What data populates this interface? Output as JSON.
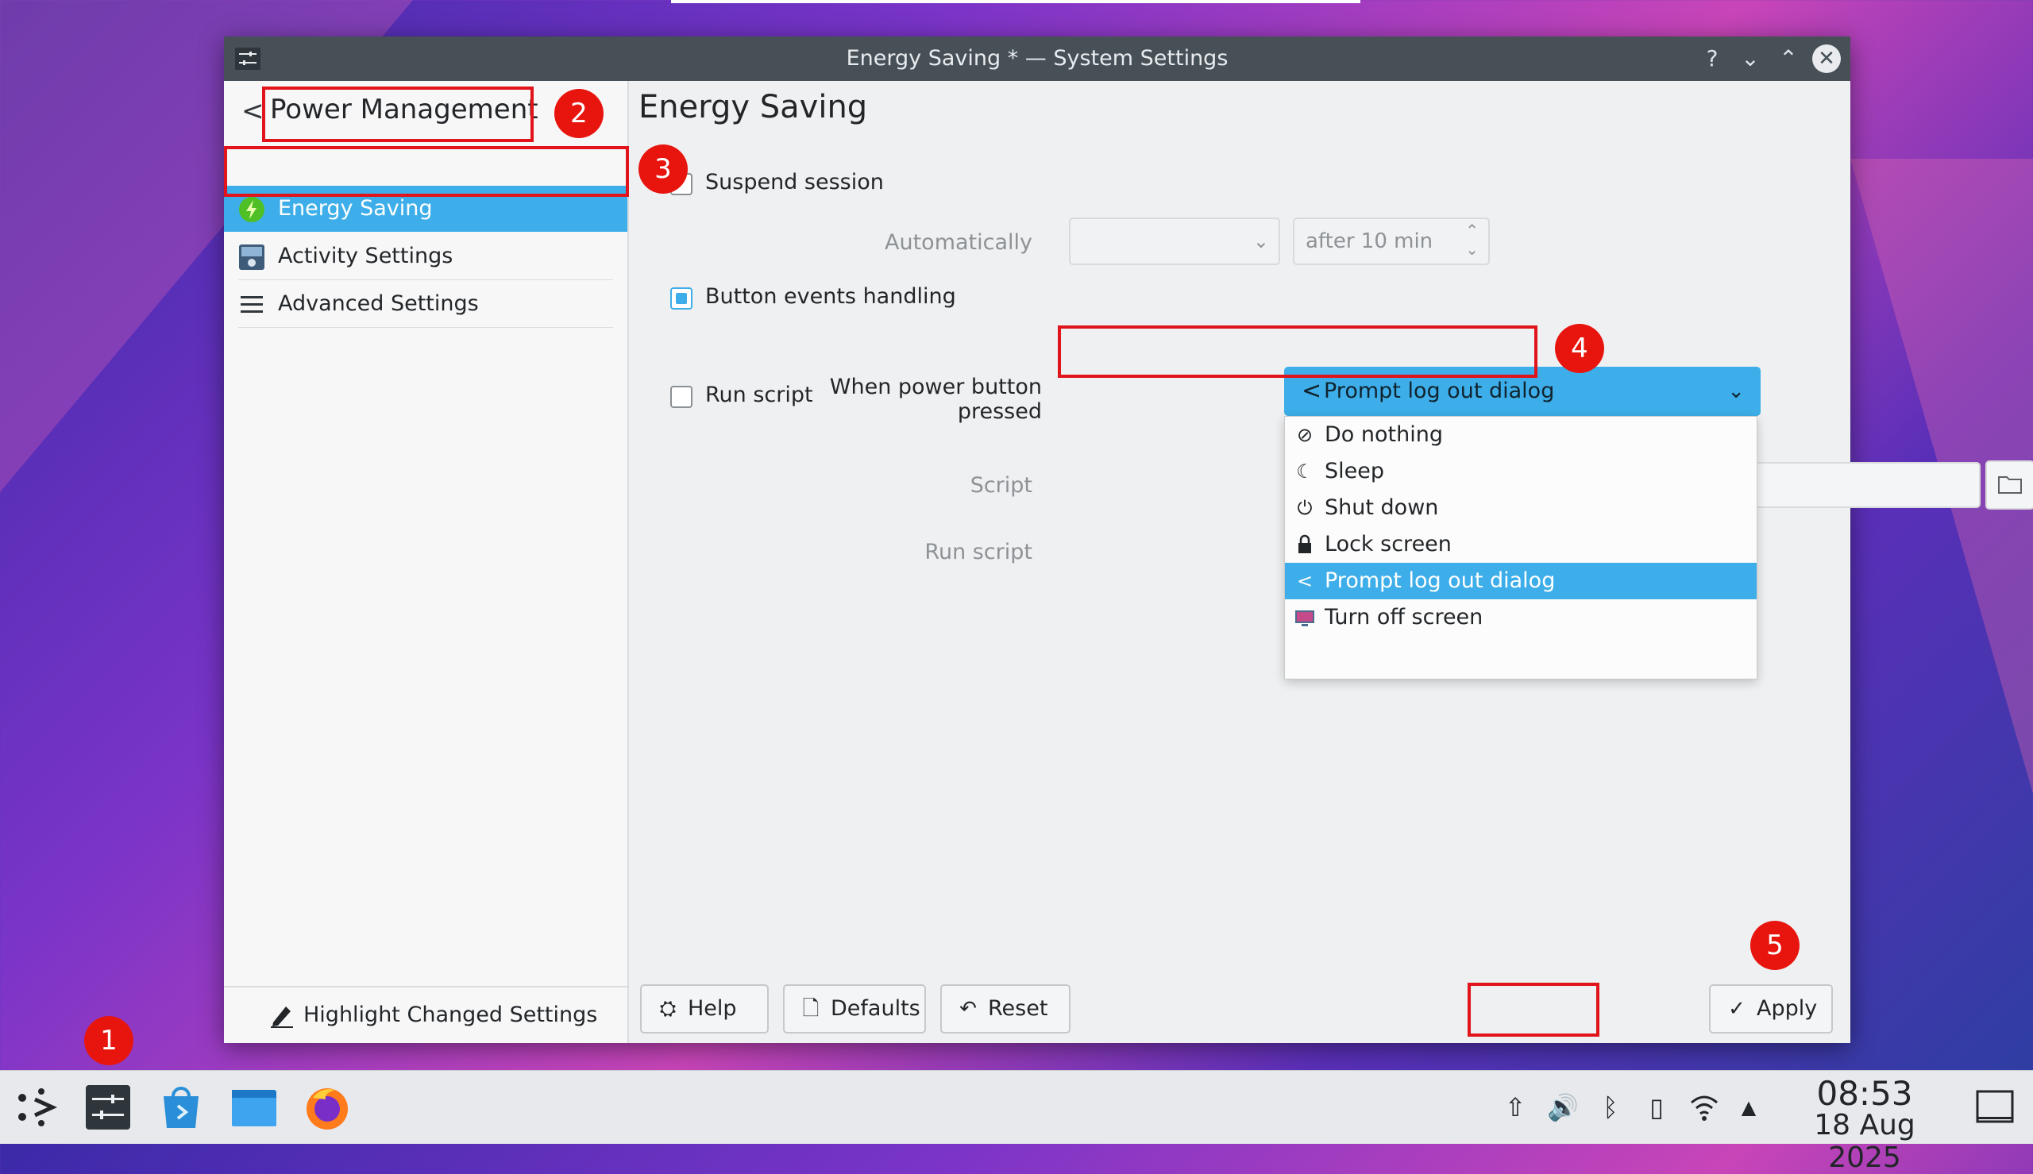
{
  "window": {
    "title": "Energy Saving * — System Settings",
    "help_glyph": "?",
    "minimize_glyph": "⌄",
    "maximize_glyph": "⌃",
    "close_glyph": "✕"
  },
  "sidebar": {
    "back_glyph": "<",
    "title": "Power Management",
    "items": [
      {
        "label": "Energy Saving",
        "icon": "energy-saving-icon",
        "selected": true
      },
      {
        "label": "Activity Settings",
        "icon": "activity-settings-icon",
        "selected": false
      },
      {
        "label": "Advanced Settings",
        "icon": "hamburger-menu-icon",
        "selected": false
      }
    ],
    "footer_label": "Highlight Changed Settings"
  },
  "content": {
    "page_title": "Energy Saving",
    "suspend_session": {
      "label": "Suspend session",
      "checked": false
    },
    "automatically_label": "Automatically",
    "automatically_value": "",
    "after_value": "after 10 min",
    "button_events": {
      "label": "Button events handling",
      "checked": true
    },
    "power_button_label": "When power button pressed",
    "power_button_value": "Prompt log out dialog",
    "run_script": {
      "label": "Run script",
      "checked": false
    },
    "script_label": "Script",
    "run_script_label": "Run script"
  },
  "dropdown": {
    "options": [
      {
        "label": "Do nothing",
        "icon": "do-nothing-icon",
        "glyph": "⊘",
        "selected": false
      },
      {
        "label": "Sleep",
        "icon": "sleep-icon",
        "glyph": "☾",
        "selected": false
      },
      {
        "label": "Shut down",
        "icon": "shutdown-icon",
        "glyph": "⏻",
        "selected": false
      },
      {
        "label": "Lock screen",
        "icon": "lock-icon",
        "glyph": "🔒",
        "selected": false
      },
      {
        "label": "Prompt log out dialog",
        "icon": "logout-icon",
        "glyph": "<",
        "selected": true
      },
      {
        "label": "Turn off screen",
        "icon": "screen-off-icon",
        "glyph": "▭",
        "selected": false
      }
    ]
  },
  "buttons": {
    "help": "Help",
    "defaults": "Defaults",
    "reset": "Reset",
    "apply": "Apply"
  },
  "annotations": [
    "1",
    "2",
    "3",
    "4",
    "5"
  ],
  "taskbar": {
    "time": "08:53",
    "date": "18 Aug 2025"
  },
  "colors": {
    "accent": "#3daee9",
    "annotation_red": "#e0141a",
    "titlebar": "#475057"
  }
}
